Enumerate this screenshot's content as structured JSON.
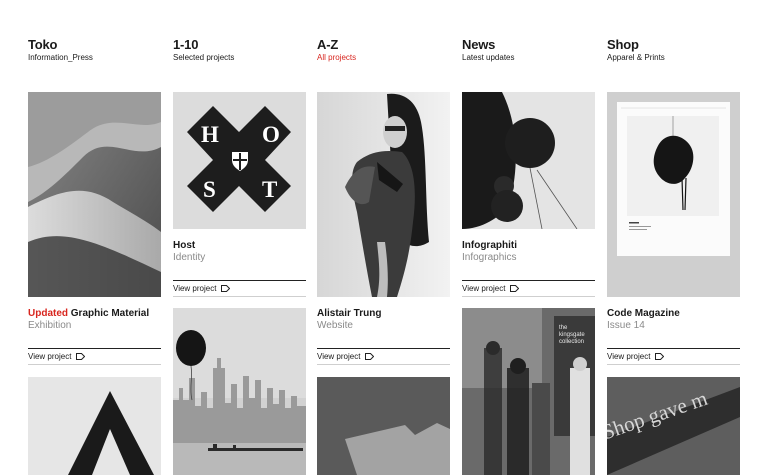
{
  "nav": [
    {
      "title": "Toko",
      "sub": "Information_Press"
    },
    {
      "title": "1-10",
      "sub": "Selected projects"
    },
    {
      "title": "A-Z",
      "sub": "All projects"
    },
    {
      "title": "News",
      "sub": "Latest updates"
    },
    {
      "title": "Shop",
      "sub": "Apparel & Prints"
    }
  ],
  "projects": {
    "host": {
      "title": "Host",
      "sub": "Identity",
      "logo_letters": [
        "H",
        "O",
        "S",
        "T"
      ]
    },
    "infographiti": {
      "title": "Infographiti",
      "sub": "Infographics"
    },
    "graphic_material": {
      "highlight": "Updated",
      "title": "Graphic Material",
      "sub": "Exhibition"
    },
    "alistair": {
      "title": "Alistair Trung",
      "sub": "Website"
    },
    "code": {
      "title": "Code Magazine",
      "sub": "Issue 14"
    }
  },
  "view_project_label": "View project",
  "photo_text": {
    "kingsgate": [
      "the",
      "kingsgate",
      "collection"
    ],
    "shop_sign": "Shop gave m"
  },
  "colors": {
    "accent": "#d8261f",
    "text": "#1a1a1a",
    "muted": "#8a8a8a"
  }
}
